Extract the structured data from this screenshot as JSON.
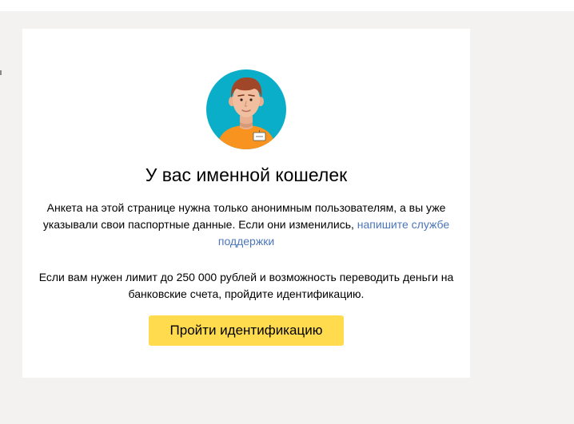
{
  "dialog": {
    "title": "У вас именной кошелек",
    "info_text": "Анкета на этой странице нужна только анонимным пользователям, а вы уже указывали свои паспортные данные. Если они изменились,",
    "support_link": "напишите службе поддержки",
    "limit_text": "Если вам нужен лимит до 250 000 рублей и возможность переводить деньги на банковские счета, пройдите идентификацию.",
    "cta_label": "Пройти идентификацию",
    "avatar_icon": "user-avatar-icon"
  },
  "colors": {
    "page_background": "#f3f2f0",
    "card_background": "#ffffff",
    "avatar_circle": "#0aaec9",
    "shirt": "#f7931e",
    "link": "#4b76bb",
    "button": "#ffdb4d"
  }
}
